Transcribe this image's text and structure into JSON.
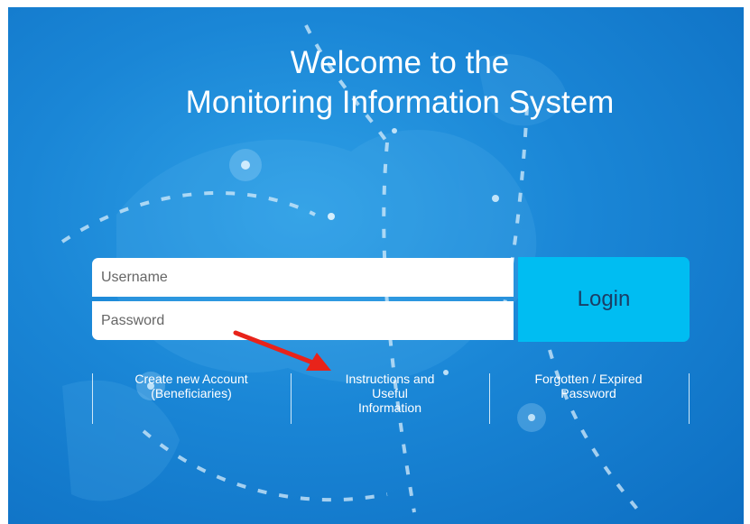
{
  "title": {
    "line1": "Welcome to the",
    "line2": "Monitoring Information System"
  },
  "login_form": {
    "username_placeholder": "Username",
    "password_placeholder": "Password",
    "login_label": "Login"
  },
  "links": [
    {
      "line1": "Create new Account",
      "line2": "(Beneficiaries)"
    },
    {
      "line1": "Instructions and",
      "line2": "Useful",
      "line3": "Information"
    },
    {
      "line1": "Forgotten / Expired",
      "line2": "Password"
    }
  ],
  "colors": {
    "background": "#1a86d6",
    "login_button": "#00bdf2",
    "annotation_arrow": "#e8231a"
  }
}
